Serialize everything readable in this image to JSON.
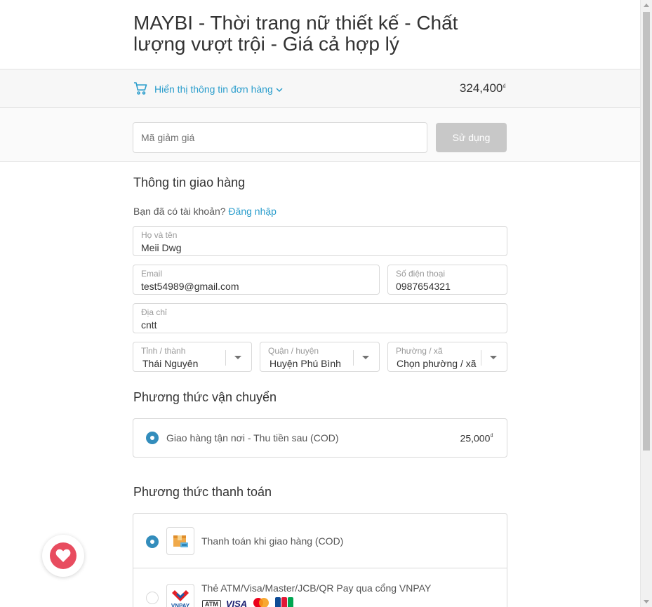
{
  "shop": {
    "title": "MAYBI - Thời trang nữ thiết kế - Chất lượng vượt trội - Giá cả hợp lý"
  },
  "summary": {
    "toggle_label": "Hiển thị thông tin đơn hàng",
    "total": "324,400",
    "currency": "₫"
  },
  "discount": {
    "placeholder": "Mã giảm giá",
    "button_label": "Sử dụng"
  },
  "shipping_info": {
    "section_title": "Thông tin giao hàng",
    "have_account_text": "Bạn đã có tài khoản?",
    "login_link": "Đăng nhập",
    "fields": {
      "name": {
        "label": "Họ và tên",
        "value": "Meii Dwg"
      },
      "email": {
        "label": "Email",
        "value": "test54989@gmail.com"
      },
      "phone": {
        "label": "Số điện thoại",
        "value": "0987654321"
      },
      "address": {
        "label": "Địa chỉ",
        "value": "cntt"
      },
      "province": {
        "label": "Tỉnh / thành",
        "value": "Thái Nguyên"
      },
      "district": {
        "label": "Quận / huyện",
        "value": "Huyện Phú Bình"
      },
      "ward": {
        "label": "Phường / xã",
        "value": "Chọn phường / xã"
      }
    }
  },
  "shipping_method": {
    "section_title": "Phương thức vận chuyển",
    "option_label": "Giao hàng tận nơi - Thu tiền sau (COD)",
    "option_price": "25,000",
    "currency": "₫",
    "selected": true
  },
  "payment_method": {
    "section_title": "Phương thức thanh toán",
    "options": [
      {
        "label": "Thanh toán khi giao hàng (COD)",
        "icon": "cod-box-icon",
        "selected": true
      },
      {
        "label": "Thẻ ATM/Visa/Master/JCB/QR Pay qua cổng VNPAY",
        "icon": "vnpay-icon",
        "selected": false,
        "card_logos": [
          "ATM",
          "VISA",
          "Mastercard",
          "JCB"
        ]
      }
    ]
  },
  "colors": {
    "accent": "#338dbc",
    "link": "#2a9dcc",
    "favorite": "#e84c5f",
    "disabled_button": "#c8c8c8"
  }
}
